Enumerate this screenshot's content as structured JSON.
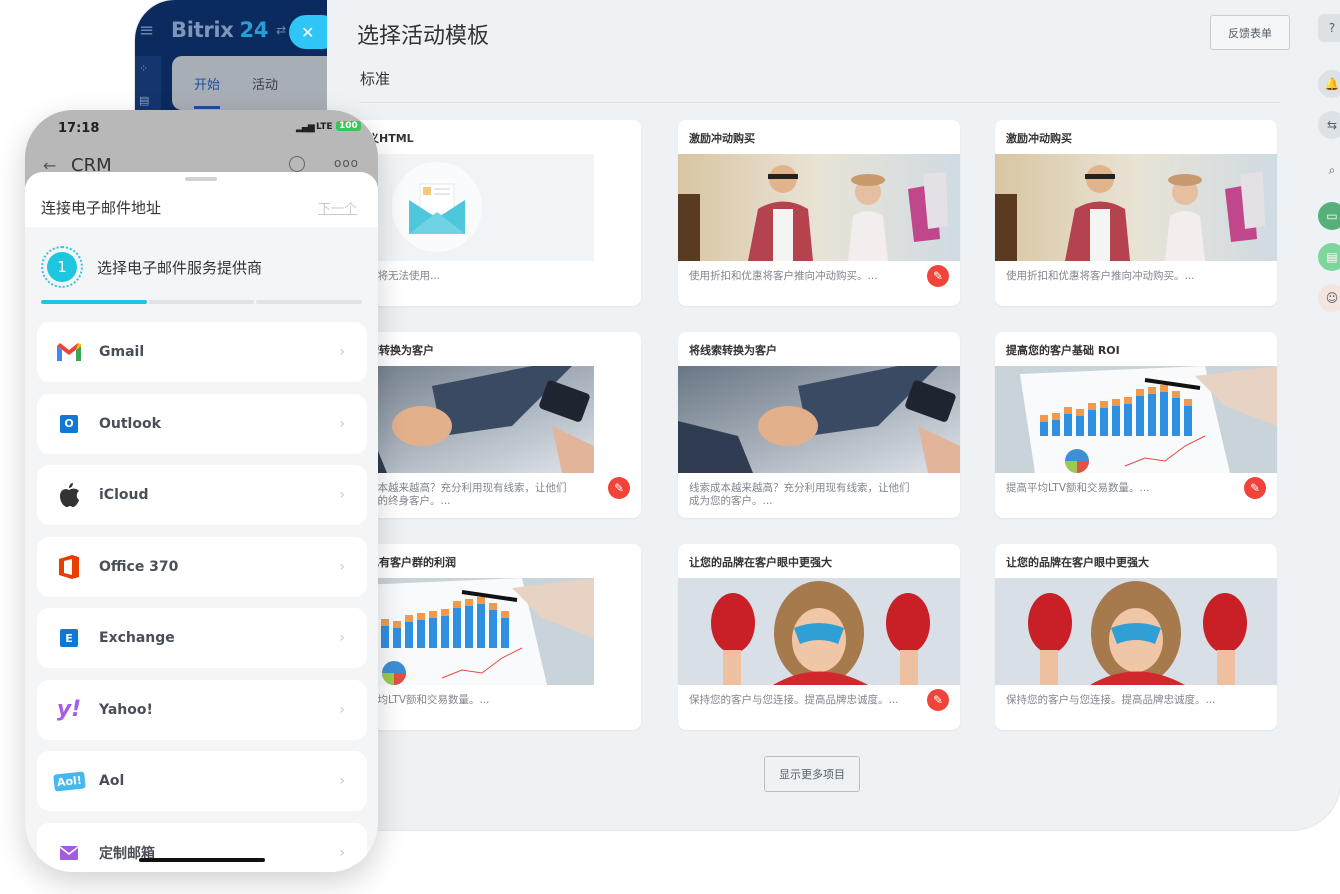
{
  "desktop": {
    "brand_name": "Bitrix",
    "brand_number": "24",
    "tabs": [
      {
        "label": "开始",
        "active": true
      },
      {
        "label": "活动",
        "active": false
      }
    ],
    "page_title": "选择活动模板",
    "feedback_button": "反馈表单",
    "section_label": "标准",
    "show_more_button": "显示更多项目",
    "templates": [
      {
        "title": "自定义HTML",
        "description": "编辑器将无法使用...",
        "image": "envelope-illustration",
        "badge": false
      },
      {
        "title": "激励冲动购买",
        "description": "使用折扣和优惠将客户推向冲动购买。...",
        "image": "shopping-couple-photo",
        "badge": true
      },
      {
        "title": "激励冲动购买",
        "description": "使用折扣和优惠将客户推向冲动购买。...",
        "image": "shopping-couple-photo",
        "badge": false
      },
      {
        "title": "将线索转换为客户",
        "description": "线索成本越来越高？充分利用现有线索，让他们成为您的终身客户。...",
        "image": "handshake-photo",
        "badge": true
      },
      {
        "title": "将线索转换为客户",
        "description": "线索成本越来越高？充分利用现有线索，让他们成为您的客户。...",
        "image": "handshake-photo",
        "badge": false
      },
      {
        "title": "提高您的客户基础 ROI",
        "description": "提高平均LTV额和交易数量。...",
        "image": "chart-report-photo",
        "badge": true
      },
      {
        "title": "提高现有客户群的利润",
        "description": "提高平均LTV额和交易数量。...",
        "image": "chart-report-photo",
        "badge": false
      },
      {
        "title": "让您的品牌在客户眼中更强大",
        "description": "保持您的客户与您连接。提高品牌忠诚度。...",
        "image": "superhero-kid-photo",
        "badge": true
      },
      {
        "title": "让您的品牌在客户眼中更强大",
        "description": "保持您的客户与您连接。提高品牌忠诚度。...",
        "image": "superhero-kid-photo",
        "badge": false
      }
    ],
    "badge_icon": "pepper-icon",
    "right_rail": [
      "help-icon",
      "bell-icon",
      "exchange-icon",
      "search-icon",
      "contact-card-icon",
      "document-icon",
      "user-avatar"
    ]
  },
  "phone": {
    "time": "17:18",
    "network": "LTE",
    "battery": "100",
    "app_title": "CRM",
    "sheet_title": "连接电子邮件地址",
    "next_link": "下一个",
    "step_number": "1",
    "step_label": "选择电子邮件服务提供商",
    "progress_steps_done": 1,
    "progress_steps_total": 3,
    "providers": [
      {
        "name": "Gmail",
        "icon": "gmail-icon"
      },
      {
        "name": "Outlook",
        "icon": "outlook-icon"
      },
      {
        "name": "iCloud",
        "icon": "apple-icon"
      },
      {
        "name": "Office 370",
        "icon": "office-icon"
      },
      {
        "name": "Exchange",
        "icon": "exchange-icon"
      },
      {
        "name": "Yahoo!",
        "icon": "yahoo-icon"
      },
      {
        "name": "Aol",
        "icon": "aol-icon"
      },
      {
        "name": "定制邮箱",
        "icon": "mail-icon"
      }
    ]
  },
  "colors": {
    "accent_cyan": "#2fc6f6",
    "nav_dark": "#0b2a5e",
    "badge_red": "#f0443a",
    "step_cyan": "#1ec6e0"
  }
}
